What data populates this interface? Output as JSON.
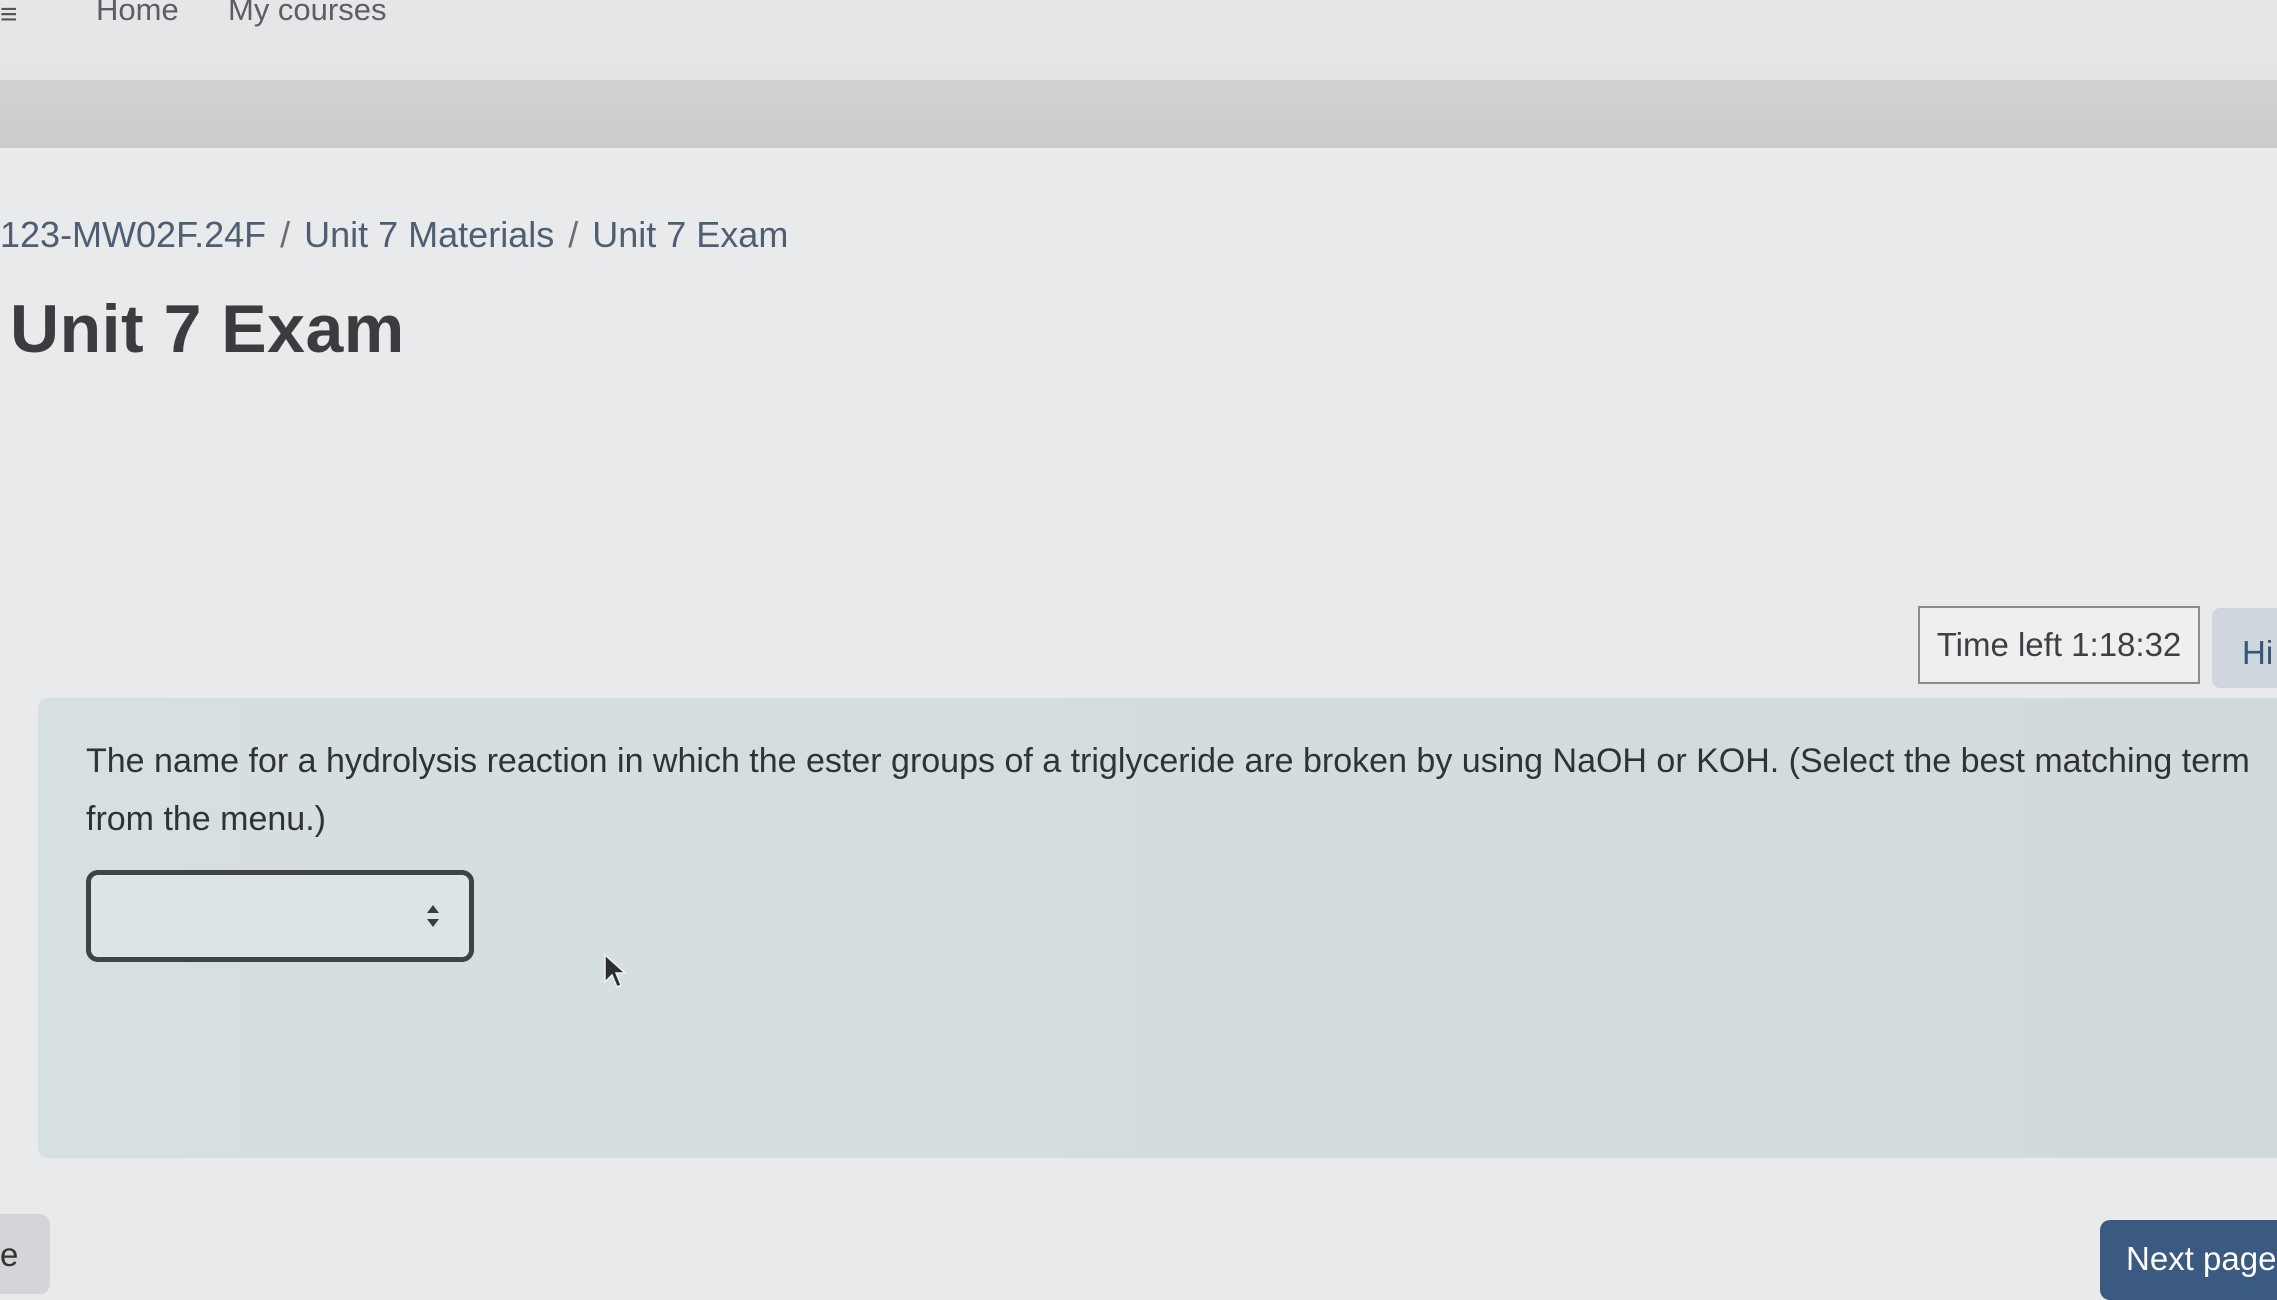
{
  "nav": {
    "home": "Home",
    "my_courses": "My courses"
  },
  "breadcrumb": {
    "course": "123-MW02F.24F",
    "section": "Unit 7 Materials",
    "page": "Unit 7 Exam",
    "separator": "/"
  },
  "page_title": "Unit 7 Exam",
  "timer": {
    "label": "Time left 1:18:32",
    "hide_label": "Hi"
  },
  "question": {
    "text": "The name for a hydrolysis reaction in which the ester groups of a triglyceride are broken by using NaOH or KOH.  (Select the best matching term from the menu.)",
    "selected_value": ""
  },
  "footer": {
    "previous_label": "e",
    "next_label": "Next page"
  },
  "colors": {
    "next_button": "#3b5a82",
    "question_panel": "#d6dfe2",
    "breadcrumb_link": "#4e5e73"
  }
}
